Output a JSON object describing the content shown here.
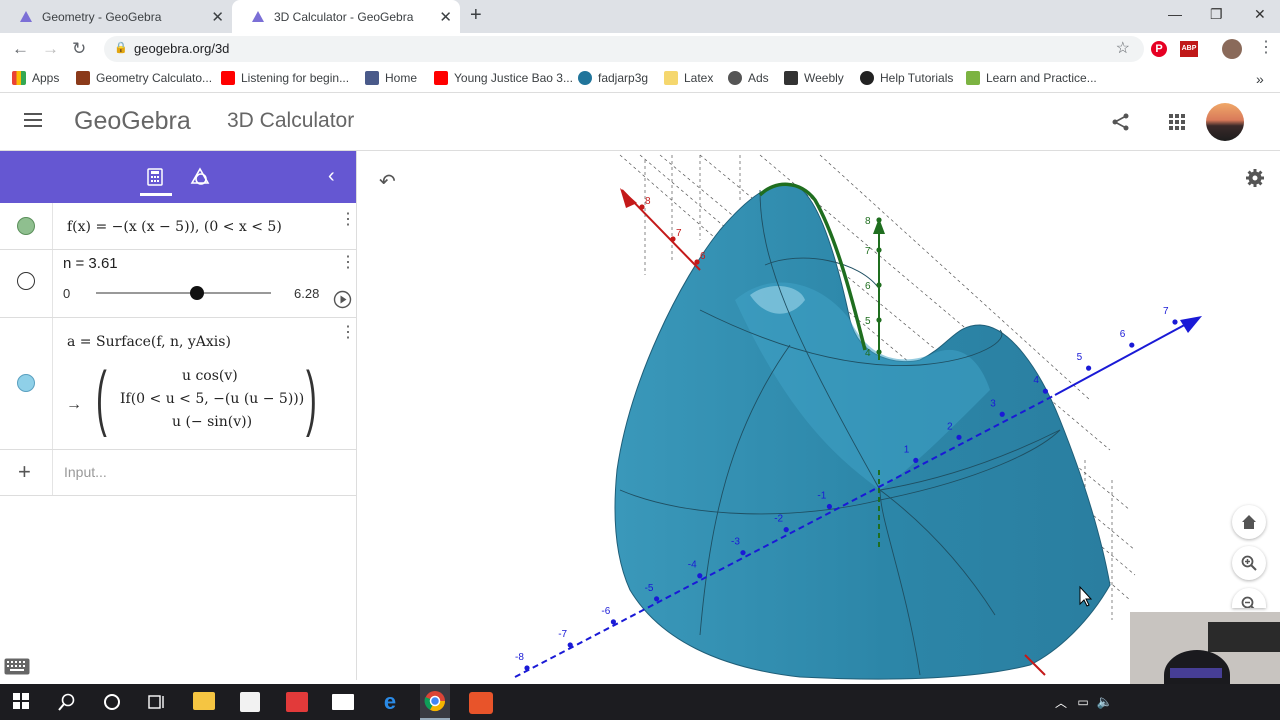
{
  "browser": {
    "tabs": [
      {
        "title": "Geometry - GeoGebra",
        "close": "✕"
      },
      {
        "title": "3D Calculator - GeoGebra",
        "close": "✕"
      }
    ],
    "new_tab": "+",
    "window_controls": {
      "minimize": "—",
      "restore": "❐",
      "close": "✕"
    },
    "url": "geogebra.org/3d",
    "bookmarks": [
      {
        "label": "Apps",
        "color": "#ea4335"
      },
      {
        "label": "Geometry Calculato...",
        "color": "#8b3a1a"
      },
      {
        "label": "Listening for begin...",
        "color": "#ff0000"
      },
      {
        "label": "Home",
        "color": "#4a5a8a"
      },
      {
        "label": "Young Justice Bao 3...",
        "color": "#ff0000"
      },
      {
        "label": "fadjarp3g",
        "color": "#21759b"
      },
      {
        "label": "Latex",
        "color": "#f5d76e"
      },
      {
        "label": "Ads",
        "color": "#555555"
      },
      {
        "label": "Weebly",
        "color": "#333333"
      },
      {
        "label": "Help Tutorials",
        "color": "#222222"
      },
      {
        "label": "Learn and Practice...",
        "color": "#7cb342"
      }
    ],
    "more_bookmarks": "»"
  },
  "app": {
    "logo": "GeoGebra",
    "title": "3D Calculator"
  },
  "algebra": {
    "collapse": "‹",
    "rows": [
      {
        "expr": "f(x)  =  −(x (x − 5)),     (0 < x < 5)",
        "color": "#8fbf8f"
      },
      {
        "expr": "n = 3.61",
        "slider_min": "0",
        "slider_max": "6.28",
        "slider_fraction": 0.575
      },
      {
        "expr": "a = Surface(f, n, yAxis)",
        "arrow": "→",
        "result": [
          "u  cos(v)",
          "If(0 < u < 5, −(u (u − 5)))",
          "u (− sin(v))"
        ],
        "color": "#8fd0e8"
      }
    ],
    "input_placeholder": "Input...",
    "add": "+"
  },
  "graphics": {
    "surface_color": "#2c86a8",
    "x_axis_color": "#1a1ad6",
    "y_axis_color": "#c41a1a",
    "z_axis_color": "#1f6e1f",
    "x_ticks": [
      "-8",
      "-7",
      "-6",
      "-5",
      "-4",
      "-3",
      "-2",
      "-1",
      "1",
      "2",
      "3",
      "4",
      "5",
      "6",
      "7"
    ],
    "y_ticks": [
      "8",
      "7",
      "6"
    ],
    "z_ticks": [
      "8",
      "7",
      "6",
      "5",
      "4"
    ]
  }
}
